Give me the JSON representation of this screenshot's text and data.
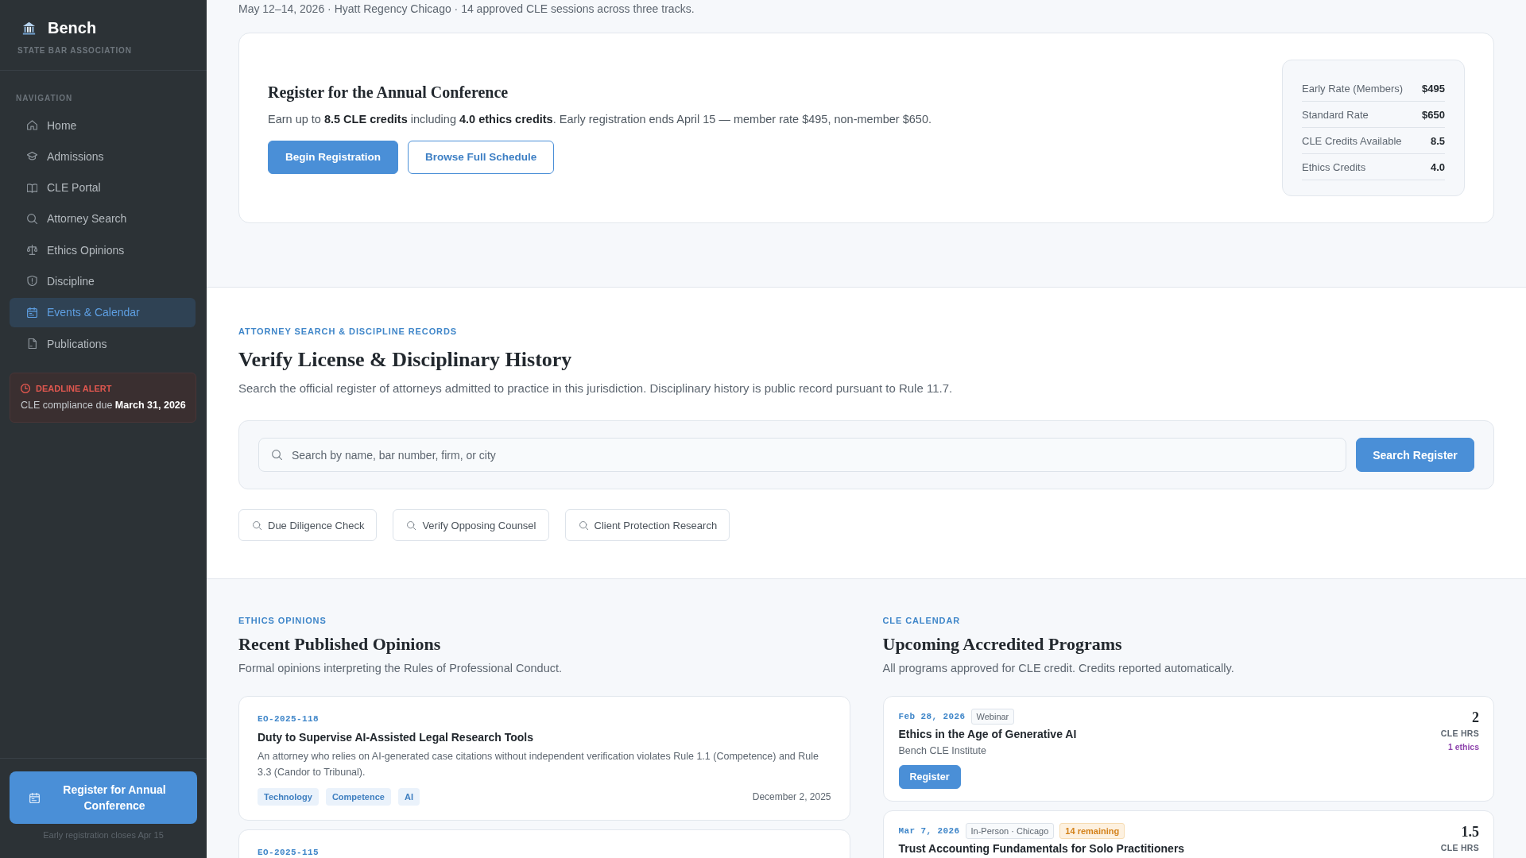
{
  "sidebar": {
    "brand": {
      "title": "Bench",
      "subtitle": "STATE BAR ASSOCIATION"
    },
    "nav_heading": "NAVIGATION",
    "items": [
      {
        "label": "Home",
        "selected": false
      },
      {
        "label": "Admissions",
        "selected": false
      },
      {
        "label": "CLE Portal",
        "selected": false
      },
      {
        "label": "Attorney Search",
        "selected": false
      },
      {
        "label": "Ethics Opinions",
        "selected": false
      },
      {
        "label": "Discipline",
        "selected": false
      },
      {
        "label": "Events & Calendar",
        "selected": true
      },
      {
        "label": "Publications",
        "selected": false
      }
    ],
    "alert": {
      "title": "DEADLINE ALERT",
      "text": "CLE compliance due **March 31, 2026**"
    },
    "cta": {
      "label": "Register for Annual Conference",
      "note": "Early registration closes Apr 15"
    }
  },
  "conference": {
    "details": "May 12–14, 2026 · Hyatt Regency Chicago · 14 approved CLE sessions across three tracks.",
    "title": "Register for the Annual Conference",
    "text": "Earn up to **8.5 CLE credits** including **4.0 ethics credits**. Early registration ends April 15 — member rate $495, non-member $650.",
    "buttons": [
      {
        "label": "Begin Registration",
        "kind": "primary"
      },
      {
        "label": "Browse Full Schedule",
        "kind": "outline"
      }
    ],
    "rates": [
      {
        "label": "Early Rate (Members)",
        "value": "$495"
      },
      {
        "label": "Standard Rate",
        "value": "$650"
      },
      {
        "label": "CLE Credits Available",
        "value": "8.5"
      },
      {
        "label": "Ethics Credits",
        "value": "4.0"
      }
    ]
  },
  "attorney_search": {
    "eyebrow": "ATTORNEY SEARCH & DISCIPLINE RECORDS",
    "title": "Verify License & Disciplinary History",
    "description": "Search the official register of attorneys admitted to practice in this jurisdiction. Disciplinary history is public record pursuant to Rule 11.7.",
    "search": {
      "placeholder": "Search by name, bar number, firm, or city"
    },
    "button": "Search Register",
    "chips": [
      "Due Diligence Check",
      "Verify Opposing Counsel",
      "Client Protection Research"
    ]
  },
  "ethics_opinions": {
    "eyebrow": "ETHICS OPINIONS",
    "title": "Recent Published Opinions",
    "description": "Formal opinions interpreting the Rules of Professional Conduct.",
    "opinions": [
      {
        "code": "EO-2025-118",
        "title": "Duty to Supervise AI-Assisted Legal Research Tools",
        "summary": "An attorney who relies on AI-generated case citations without independent verification violates Rule 1.1 (Competence) and Rule 3.3 (Candor to Tribunal).",
        "tags": [
          "Technology",
          "Competence",
          "AI"
        ],
        "date": "December 2, 2025"
      },
      {
        "code": "EO-2025-115"
      }
    ]
  },
  "cle_calendar": {
    "eyebrow": "CLE CALENDAR",
    "title": "Upcoming Accredited Programs",
    "description": "All programs approved for CLE credit. Credits reported automatically.",
    "programs": [
      {
        "date": "Feb 28, 2026",
        "tags": [
          {
            "label": "Webinar",
            "kind": "format"
          }
        ],
        "title": "Ethics in the Age of Generative AI",
        "provider": "Bench CLE Institute",
        "button": "Register",
        "hours": "2",
        "hours_label": "CLE HRS",
        "ethics": "1 ethics"
      },
      {
        "date": "Mar 7, 2026",
        "tags": [
          {
            "label": "In-Person · Chicago",
            "kind": "format"
          },
          {
            "label": "14 remaining",
            "kind": "seats"
          }
        ],
        "title": "Trust Accounting Fundamentals for Solo Practitioners",
        "hours": "1.5",
        "hours_label": "CLE HRS"
      }
    ]
  }
}
